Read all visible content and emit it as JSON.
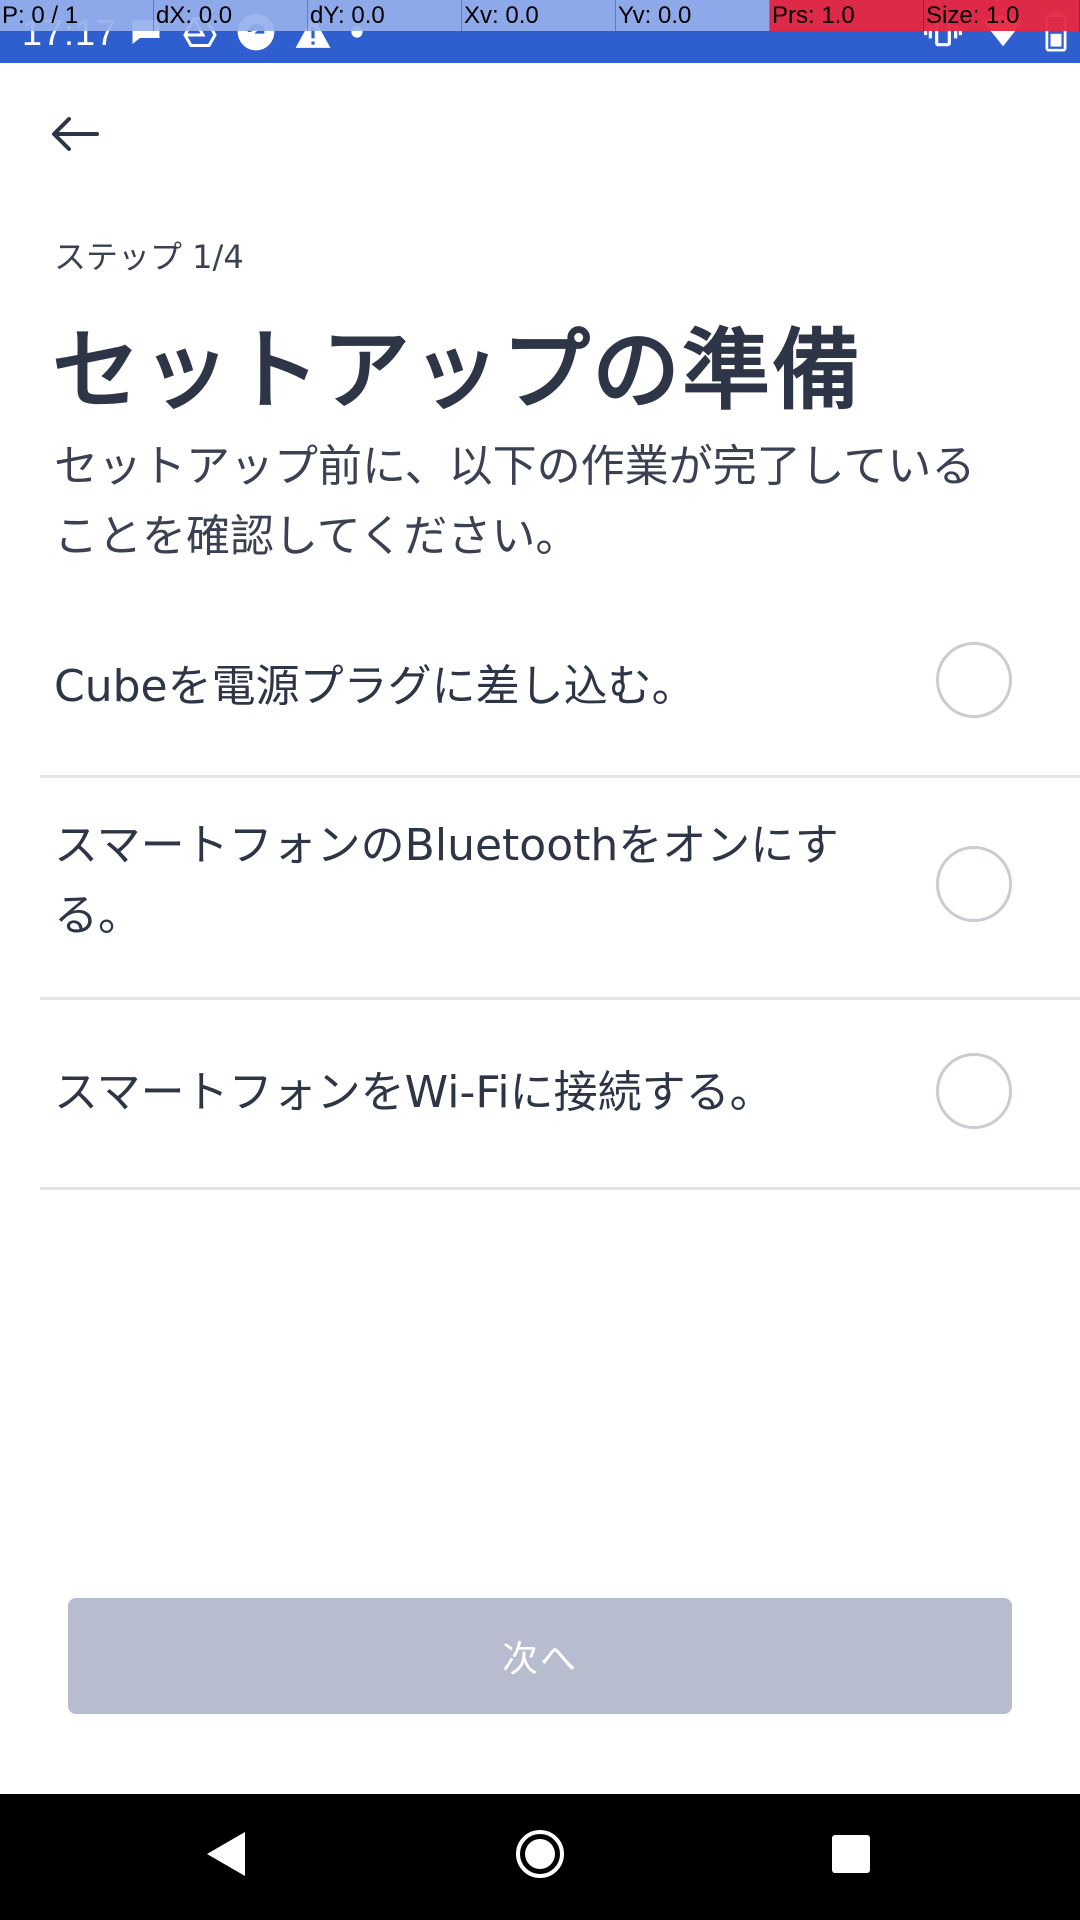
{
  "status_bar": {
    "time": "17:17",
    "left_icons": [
      "message-icon",
      "drive-icon",
      "sync-icon",
      "warning-icon",
      "dot-icon"
    ],
    "right_icons": [
      "vibrate-icon",
      "wifi-icon",
      "battery-icon"
    ],
    "background_color": "#2f5fcf"
  },
  "pointer_overlay": {
    "cells": [
      {
        "label": "P: 0 / 1"
      },
      {
        "label": "dX: 0.0"
      },
      {
        "label": "dY: 0.0"
      },
      {
        "label": "Xv: 0.0"
      },
      {
        "label": "Yv: 0.0"
      },
      {
        "label": "Prs: 1.0"
      },
      {
        "label": "Size: 1.0"
      }
    ]
  },
  "header": {
    "back_icon": "arrow-left-icon",
    "step_label": "ステップ 1/4",
    "title": "セットアップの準備",
    "description": "セットアップ前に、以下の作業が完了していることを確認してください。"
  },
  "checklist": {
    "items": [
      {
        "label": "Cubeを電源プラグに差し込む。",
        "checked": false
      },
      {
        "label": "スマートフォンのBluetoothをオンにする。",
        "checked": false
      },
      {
        "label": "スマートフォンをWi-Fiに接続する。",
        "checked": false
      }
    ]
  },
  "next_button": {
    "label": "次へ",
    "enabled": false,
    "color": "#b8bccf"
  },
  "nav_bar": {
    "items": [
      "back-triangle-icon",
      "home-circle-icon",
      "recents-square-icon"
    ]
  },
  "colors": {
    "text_primary": "#2e3547",
    "divider": "#e3e5ea",
    "circle_border": "#c9ccd3"
  }
}
